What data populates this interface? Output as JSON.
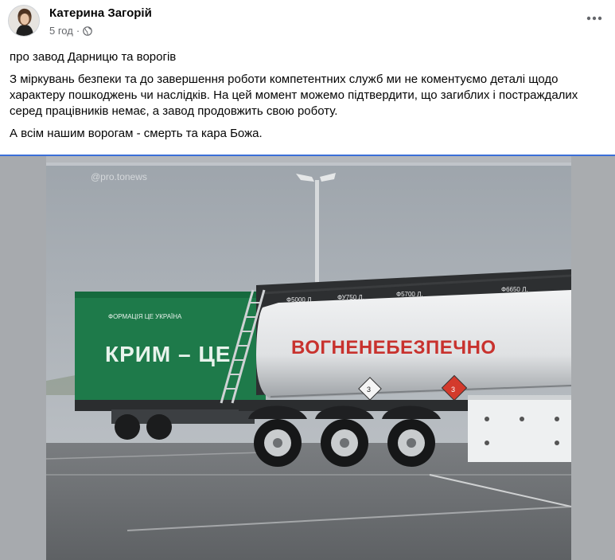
{
  "post": {
    "author": "Катерина Загорій",
    "time": "5 год",
    "separator": "·",
    "privacy_icon": "globe-icon",
    "more_icon": "more-horizontal-icon",
    "paragraphs": [
      "про завод Дарницю та ворогів",
      "З міркувань безпеки та до завершення роботи компетентних служб ми не коментуємо деталі щодо характеру пошкоджень чи наслідків. На цей момент можемо підтвердити, що загиблих і постраждалих серед працівників немає, а завод продовжить свою роботу.",
      "А всім нашим ворогам - смерть та кара Божа."
    ]
  },
  "photo": {
    "watermark": "@pro.tonews",
    "truck_sign": "КРИМ – ЦЕ",
    "truck_logo": "ФОРМАЦІЯ ЦЕ УКРАЇНА",
    "tanker_text": "ВОГНЕНЕБЕЗПЕЧНО",
    "compartments": [
      "Ф5000 Л.",
      "ФУ750 Л.",
      "Ф5700 Л.",
      "Ф6650 Л."
    ],
    "hazard_labels": [
      "3",
      "3"
    ]
  },
  "colors": {
    "accent_divider": "#3b6fd8",
    "truck_green": "#1e7a4a",
    "tanker_text_red": "#c8322e"
  }
}
